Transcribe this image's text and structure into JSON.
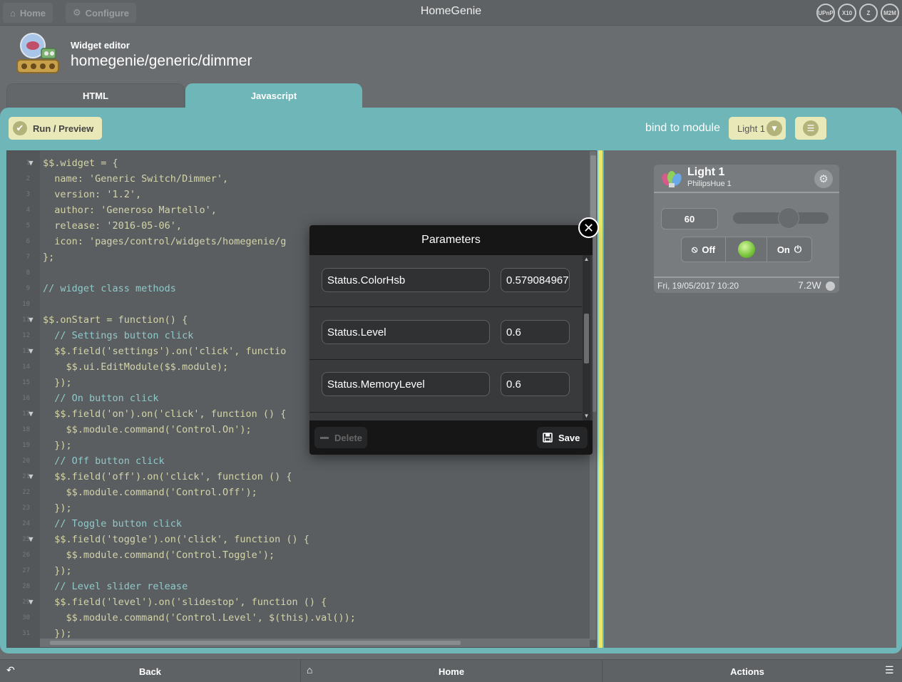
{
  "topbar": {
    "home_label": "Home",
    "configure_label": "Configure",
    "app_title": "HomeGenie",
    "logos": [
      "UPnP",
      "X10",
      "Z",
      "M2M"
    ]
  },
  "header": {
    "subtitle": "Widget editor",
    "title": "homegenie/generic/dimmer"
  },
  "tabs": [
    {
      "label": "HTML",
      "active": false
    },
    {
      "label": "Javascript",
      "active": true
    }
  ],
  "toolbar": {
    "run_label": "Run / Preview",
    "bind_label": "bind to module",
    "module_selected": "Light 1"
  },
  "editor": {
    "lines": [
      {
        "n": "1",
        "fold": true,
        "text": "$$.widget = {",
        "comment": false
      },
      {
        "n": "2",
        "fold": false,
        "text": "  name: 'Generic Switch/Dimmer',",
        "comment": false
      },
      {
        "n": "3",
        "fold": false,
        "text": "  version: '1.2',",
        "comment": false
      },
      {
        "n": "4",
        "fold": false,
        "text": "  author: 'Generoso Martello',",
        "comment": false
      },
      {
        "n": "5",
        "fold": false,
        "text": "  release: '2016-05-06',",
        "comment": false
      },
      {
        "n": "6",
        "fold": false,
        "text": "  icon: 'pages/control/widgets/homegenie/g",
        "comment": false
      },
      {
        "n": "7",
        "fold": false,
        "text": "};",
        "comment": false
      },
      {
        "n": "8",
        "fold": false,
        "text": "",
        "comment": false
      },
      {
        "n": "9",
        "fold": false,
        "text": "// widget class methods",
        "comment": true
      },
      {
        "n": "10",
        "fold": false,
        "text": "",
        "comment": false
      },
      {
        "n": "11",
        "fold": true,
        "text": "$$.onStart = function() {",
        "comment": false
      },
      {
        "n": "12",
        "fold": false,
        "text": "  // Settings button click",
        "comment": true
      },
      {
        "n": "13",
        "fold": true,
        "text": "  $$.field('settings').on('click', functio",
        "comment": false
      },
      {
        "n": "14",
        "fold": false,
        "text": "    $$.ui.EditModule($$.module);",
        "comment": false
      },
      {
        "n": "15",
        "fold": false,
        "text": "  });",
        "comment": false
      },
      {
        "n": "16",
        "fold": false,
        "text": "  // On button click",
        "comment": true
      },
      {
        "n": "17",
        "fold": true,
        "text": "  $$.field('on').on('click', function () {",
        "comment": false
      },
      {
        "n": "18",
        "fold": false,
        "text": "    $$.module.command('Control.On');",
        "comment": false
      },
      {
        "n": "19",
        "fold": false,
        "text": "  });",
        "comment": false
      },
      {
        "n": "20",
        "fold": false,
        "text": "  // Off button click",
        "comment": true
      },
      {
        "n": "21",
        "fold": true,
        "text": "  $$.field('off').on('click', function () {",
        "comment": false
      },
      {
        "n": "22",
        "fold": false,
        "text": "    $$.module.command('Control.Off');",
        "comment": false
      },
      {
        "n": "23",
        "fold": false,
        "text": "  });",
        "comment": false
      },
      {
        "n": "24",
        "fold": false,
        "text": "  // Toggle button click",
        "comment": true
      },
      {
        "n": "25",
        "fold": true,
        "text": "  $$.field('toggle').on('click', function () {",
        "comment": false
      },
      {
        "n": "26",
        "fold": false,
        "text": "    $$.module.command('Control.Toggle');",
        "comment": false
      },
      {
        "n": "27",
        "fold": false,
        "text": "  });",
        "comment": false
      },
      {
        "n": "28",
        "fold": false,
        "text": "  // Level slider release",
        "comment": true
      },
      {
        "n": "29",
        "fold": true,
        "text": "  $$.field('level').on('slidestop', function () {",
        "comment": false
      },
      {
        "n": "30",
        "fold": false,
        "text": "    $$.module.command('Control.Level', $(this).val());",
        "comment": false
      },
      {
        "n": "31",
        "fold": false,
        "text": "  });",
        "comment": false
      }
    ]
  },
  "widget": {
    "name": "Light 1",
    "address": "PhilipsHue 1",
    "level": "60",
    "level_fraction": 0.6,
    "off_label": "Off",
    "on_label": "On",
    "timestamp": "Fri, 19/05/2017 10:20",
    "power": "7.2W"
  },
  "dialog": {
    "title": "Parameters",
    "params": [
      {
        "name": "Status.ColorHsb",
        "value": "0.579084967"
      },
      {
        "name": "Status.Level",
        "value": "0.6"
      },
      {
        "name": "Status.MemoryLevel",
        "value": "0.6"
      }
    ],
    "delete_label": "Delete",
    "save_label": "Save"
  },
  "footer": {
    "back_label": "Back",
    "home_label": "Home",
    "actions_label": "Actions"
  }
}
